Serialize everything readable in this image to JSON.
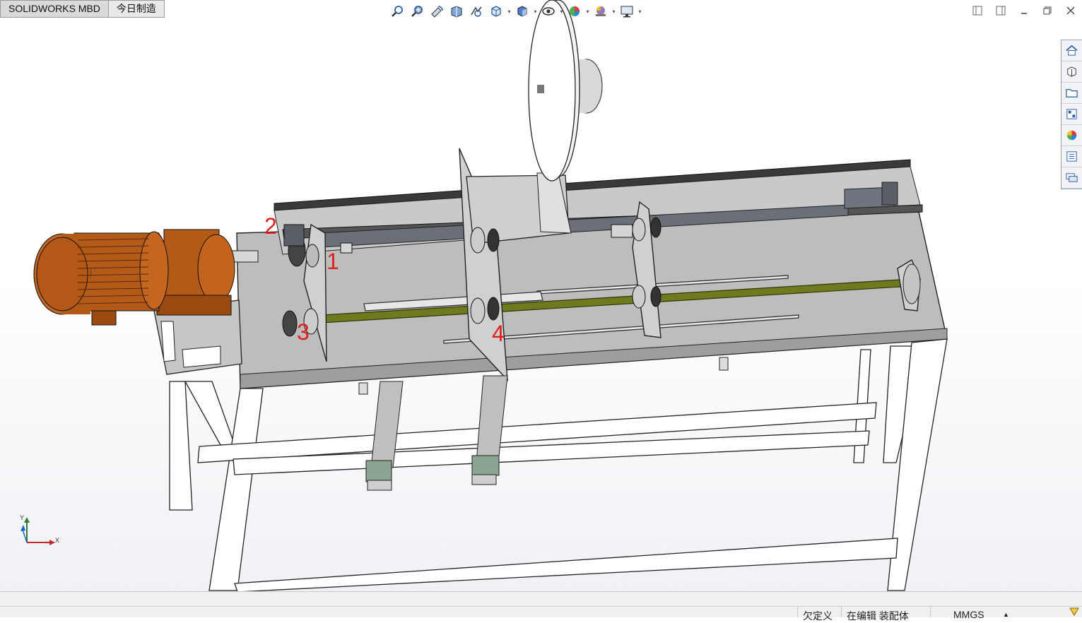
{
  "tabs": [
    {
      "label": "SOLIDWORKS MBD"
    },
    {
      "label": "今日制造"
    }
  ],
  "view_toolbar": {
    "icons": [
      "zoom-to-fit-icon",
      "zoom-to-area-icon",
      "previous-view-icon",
      "section-view-icon",
      "dynamic-annotation-icon",
      "view-orientation-icon",
      "display-style-icon",
      "hide-show-items-icon",
      "edit-appearance-icon",
      "apply-scene-icon",
      "view-settings-icon"
    ]
  },
  "window_controls": [
    "restore-left-icon",
    "restore-right-icon",
    "minimize-icon",
    "restore-icon",
    "close-icon"
  ],
  "task_pane": [
    "home-icon",
    "design-library-icon",
    "file-explorer-icon",
    "view-palette-icon",
    "appearances-icon",
    "custom-properties-icon",
    "forum-icon"
  ],
  "callouts": {
    "c1": "1",
    "c2": "2",
    "c3": "3",
    "c4": "4"
  },
  "triad": {
    "x": "X",
    "y": "Y"
  },
  "status": {
    "definition": "欠定义",
    "editing": "在编辑 装配体",
    "units": "MMGS",
    "units_arrow": "▲"
  },
  "colors": {
    "motor": "#b45a17",
    "frame": "#cfcfcf",
    "shaft": "#6f7a1e",
    "callout": "#e0201f"
  }
}
